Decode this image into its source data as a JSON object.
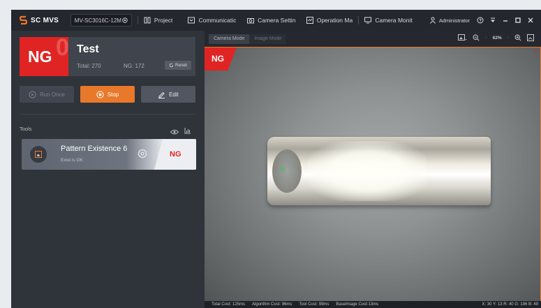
{
  "app": {
    "title": "SC MVS",
    "device": "MV-SC3016C-12M",
    "menu": [
      {
        "label": "Project",
        "icon": "project-icon"
      },
      {
        "label": "Communicatic",
        "icon": "communication-icon"
      },
      {
        "label": "Camera Settin",
        "icon": "camera-settings-icon"
      },
      {
        "label": "Operation Ma",
        "icon": "operation-icon"
      },
      {
        "label": "Camera Monit",
        "icon": "monitor-icon"
      }
    ],
    "user": "Administrator"
  },
  "result": {
    "status": "NG",
    "ghost": "0",
    "project_name": "Test",
    "total": "Total: 270",
    "ng_count": "NG: 172",
    "reset_label": "Reset"
  },
  "actions": {
    "run_once": "Run Once",
    "stop": "Stop",
    "edit": "Edit"
  },
  "tools": {
    "label": "Tools",
    "items": [
      {
        "name": "Pattern Existence 6",
        "sub": "Exist is OK",
        "status": "NG"
      }
    ]
  },
  "viewer": {
    "tabs": [
      {
        "label": "Camera Mode",
        "active": true
      },
      {
        "label": "Image Mode",
        "active": false
      }
    ],
    "zoom": "62%",
    "overlay_status": "NG",
    "status_bar": {
      "total_cost": "Total Cost: 125ms",
      "algorithm_cost": "Algorithm Cost: 96ms",
      "tool_cost": "Tool Cost: 99ms",
      "base_image_cost": "BaseImage Cost:13ms",
      "pixel_info": "X: 30 Y: 13  R: 40 G: 196 B: 49"
    }
  },
  "colors": {
    "accent_orange": "#e8782a",
    "ng_red": "#e02424",
    "panel_bg": "#2f333a"
  }
}
